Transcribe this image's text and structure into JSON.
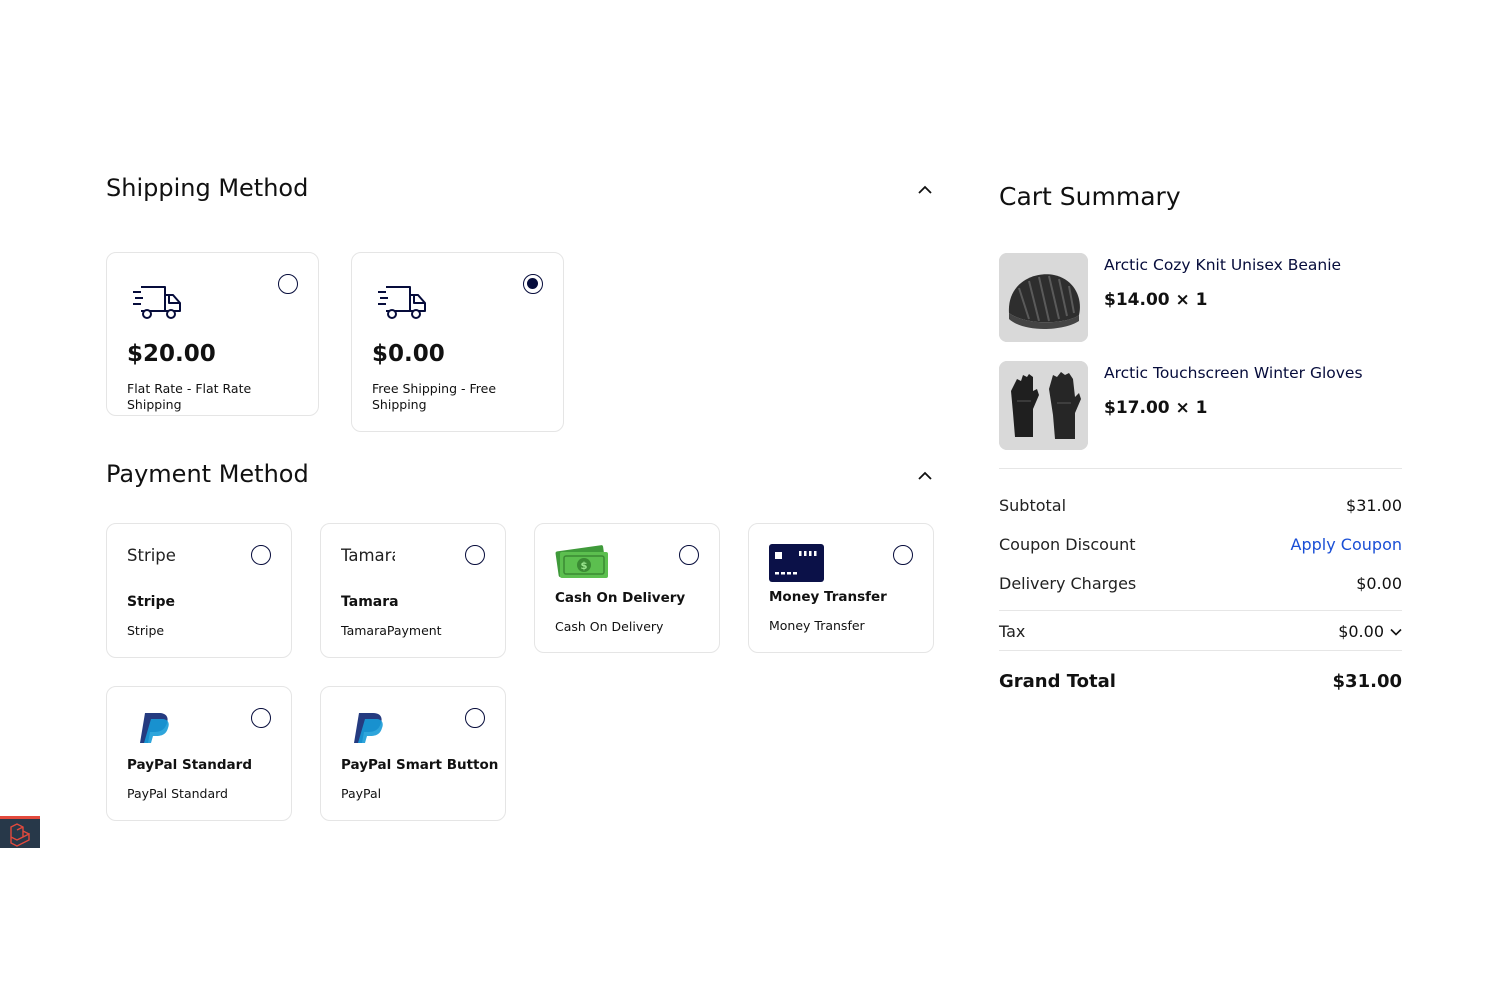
{
  "shipping": {
    "title": "Shipping Method",
    "options": [
      {
        "price": "$20.00",
        "description": "Flat Rate - Flat Rate Shipping",
        "selected": false,
        "icon": "truck-icon"
      },
      {
        "price": "$0.00",
        "description": "Free Shipping - Free Shipping",
        "selected": true,
        "icon": "truck-icon"
      }
    ]
  },
  "payment": {
    "title": "Payment Method",
    "options": [
      {
        "logo_text": "Stripe",
        "title": "Stripe",
        "subtitle": "Stripe"
      },
      {
        "logo_text": "Tamara",
        "title": "Tamara",
        "subtitle": "TamaraPayment"
      },
      {
        "logo_icon": "cash-icon",
        "title": "Cash On Delivery",
        "subtitle": "Cash On Delivery"
      },
      {
        "logo_icon": "money-transfer-card-icon",
        "title": "Money Transfer",
        "subtitle": "Money Transfer"
      },
      {
        "logo_icon": "paypal-icon",
        "title": "PayPal Standard",
        "subtitle": "PayPal Standard"
      },
      {
        "logo_icon": "paypal-icon",
        "title": "PayPal Smart Button",
        "subtitle": "PayPal"
      }
    ]
  },
  "cart": {
    "title": "Cart Summary",
    "items": [
      {
        "name": "Arctic Cozy Knit Unisex Beanie",
        "price_qty": "$14.00 × 1",
        "image": "beanie-image"
      },
      {
        "name": "Arctic Touchscreen Winter Gloves",
        "price_qty": "$17.00 × 1",
        "image": "gloves-image"
      }
    ],
    "subtotal_label": "Subtotal",
    "subtotal_value": "$31.00",
    "coupon_label": "Coupon Discount",
    "coupon_action": "Apply Coupon",
    "delivery_label": "Delivery Charges",
    "delivery_value": "$0.00",
    "tax_label": "Tax",
    "tax_value": "$0.00",
    "grand_total_label": "Grand Total",
    "grand_total_value": "$31.00"
  },
  "colors": {
    "primary": "#060c3b",
    "link": "#1a4fd6",
    "border": "#e5e5e5"
  }
}
